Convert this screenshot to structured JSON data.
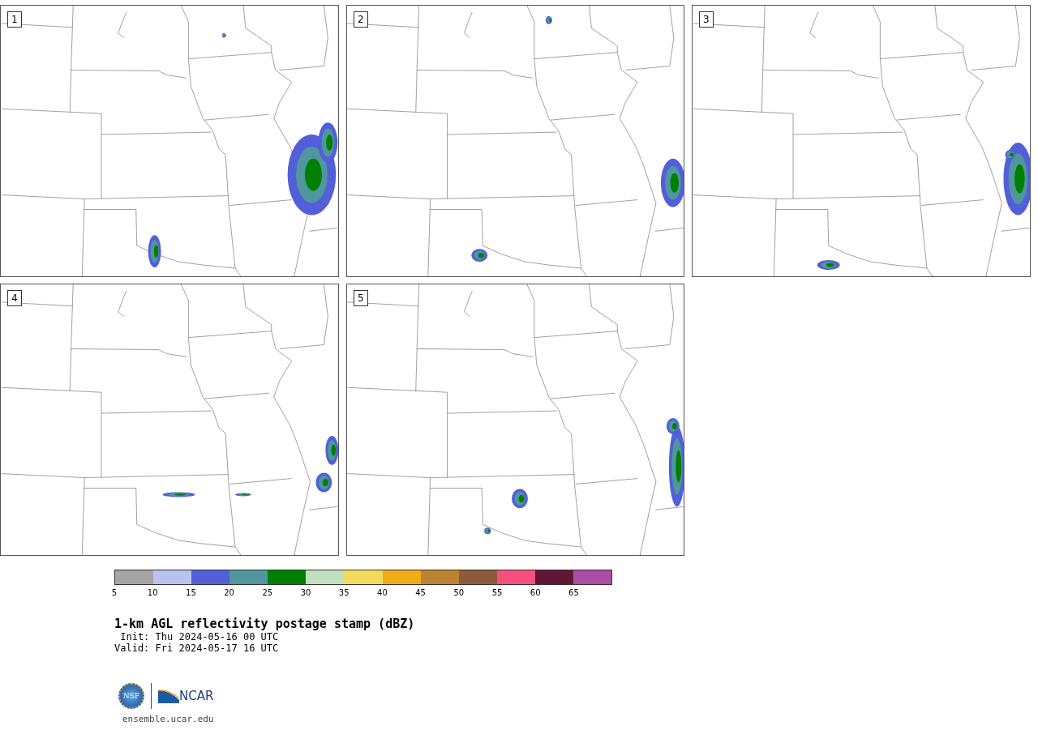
{
  "panels": [
    {
      "label": "1"
    },
    {
      "label": "2"
    },
    {
      "label": "3"
    },
    {
      "label": "4"
    },
    {
      "label": "5"
    }
  ],
  "colorbar": {
    "segments": [
      {
        "color": "#a5a5a5"
      },
      {
        "color": "#b9c3ee"
      },
      {
        "color": "#525fd8"
      },
      {
        "color": "#50969e"
      },
      {
        "color": "#008000"
      },
      {
        "color": "#c0dfbf"
      },
      {
        "color": "#f0dc5a"
      },
      {
        "color": "#f0ac16"
      },
      {
        "color": "#bb8330"
      },
      {
        "color": "#8c5a3e"
      },
      {
        "color": "#f7507e"
      },
      {
        "color": "#621635"
      },
      {
        "color": "#ad4ca5"
      }
    ],
    "ticks": [
      "5",
      "10",
      "15",
      "20",
      "25",
      "30",
      "35",
      "40",
      "45",
      "50",
      "55",
      "60",
      "65"
    ]
  },
  "title": "1-km AGL reflectivity postage stamp (dBZ)",
  "init": " Init: Thu 2024-05-16 00 UTC",
  "valid": "Valid: Fri 2024-05-17 16 UTC",
  "logos": {
    "left": "NSF",
    "right": "NCAR"
  },
  "url": "ensemble.ucar.edu"
}
